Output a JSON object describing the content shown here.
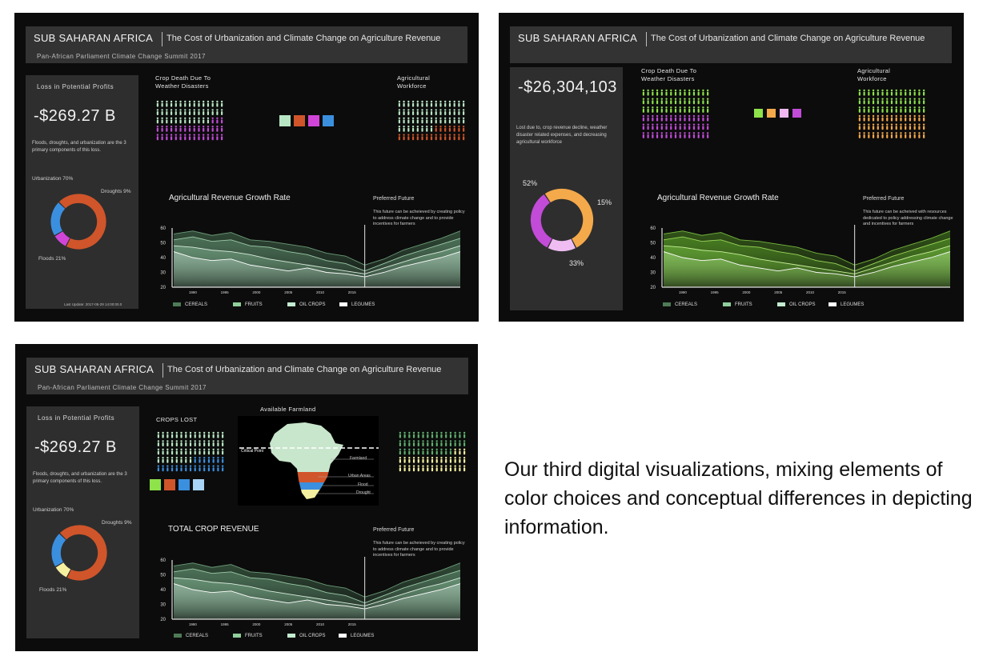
{
  "header": {
    "region": "SUB SAHARAN AFRICA",
    "title": "The Cost of Urbanization and Climate Change on Agriculture Revenue",
    "subtitle": "Pan-African Parliament Climate Change Summit 2017"
  },
  "caption": "Our third digital visualizations, mixing elements of color choices and conceptual differences in depicting information.",
  "colors": {
    "cereals": "#4e7a56",
    "fruits": "#8fcf9c",
    "oil_crops": "#c3ecd0",
    "legumes": "#ffffff",
    "orange": "#d0552a",
    "blue": "#3b8fdf",
    "magenta": "#d045d8"
  },
  "panel1": {
    "side_title": "Loss in Potential Profits",
    "big_value": "-$269.27 B",
    "description": "Floods, droughts, and urbanization are the 3 primary components of this loss.",
    "label_urbanization": "Urbanization 70%",
    "label_droughts": "Droughts 9%",
    "label_floods": "Floods 21%",
    "last_update": "Last Update: 2017-05-29 14:00:00.0",
    "crop_death_title": [
      "Crop Death Due To",
      "Weather Disasters"
    ],
    "workforce_title": [
      "Agricultural",
      "Workforce"
    ],
    "chart_title": "Agricultural Revenue Growth Rate",
    "preferred_title": "Preferred Future",
    "preferred_text": "This future can be acheieved by creating policy to address climate change and to provide incentives for farmers",
    "swatch_colors": [
      "#b8e6c4",
      "#d0552a",
      "#d045d8",
      "#3b8fdf"
    ],
    "donut": {
      "segments": [
        {
          "color": "#d0552a",
          "value": 70
        },
        {
          "color": "#d045d8",
          "value": 9
        },
        {
          "color": "#3b8fdf",
          "value": 21
        }
      ]
    }
  },
  "panel2": {
    "big_value": "-$26,304,103",
    "description": "Lost due to, crop revenue decline, weather disaster related expenses, and decreasing agricultural workforce",
    "pct_52": "52%",
    "pct_15": "15%",
    "pct_33": "33%",
    "crop_death_title": [
      "Crop Death Due To",
      "Weather Disasters"
    ],
    "workforce_title": [
      "Agricultural",
      "Workforce"
    ],
    "chart_title": "Agricultural Revenue Growth Rate",
    "preferred_title": "Preferred Future",
    "preferred_text": "This future can be acheived with resources dedicated to policy addressing climate change and incentives for farmers",
    "swatch_colors": [
      "#8ee24a",
      "#f4a94a",
      "#f0b8f0",
      "#c24bd8"
    ],
    "donut": {
      "segments": [
        {
          "color": "#f4a94a",
          "value": 52
        },
        {
          "color": "#efbdf2",
          "value": 15
        },
        {
          "color": "#c24bd8",
          "value": 33
        }
      ]
    }
  },
  "panel3": {
    "side_title": "Loss in Potential Profits",
    "big_value": "-$269.27 B",
    "description": "Floods, droughts, and urbanization are the 3 primary components of this loss.",
    "label_urbanization": "Urbanization 70%",
    "label_droughts": "Droughts 9%",
    "label_floods": "Floods 21%",
    "crops_lost_title": "CROPS LOST",
    "farmland_title": "Available Farmland",
    "critical_point": "Critical Point",
    "map_labels": [
      "Farmland",
      "Urban Areas",
      "Flood",
      "Drought"
    ],
    "chart_title": "TOTAL CROP REVENUE",
    "preferred_title": "Preferred Future",
    "preferred_text": "This future can be acheieved by creating policy to address climate change and to provide incentives for farmers",
    "swatch_colors": [
      "#8ee24a",
      "#d0552a",
      "#3b8fdf",
      "#a8d4f5"
    ],
    "donut": {
      "segments": [
        {
          "color": "#d0552a",
          "value": 70
        },
        {
          "color": "#f5f0a0",
          "value": 9
        },
        {
          "color": "#3b8fdf",
          "value": 21
        }
      ]
    }
  },
  "legend": [
    "CEREALS",
    "FRUITS",
    "OIL CROPS",
    "LEGUMES"
  ],
  "chart_data": {
    "type": "area",
    "x_ticks": [
      "1990",
      "1995",
      "2000",
      "2005",
      "2010",
      "2015"
    ],
    "y_ticks": [
      "20",
      "30",
      "40",
      "50",
      "60"
    ],
    "ylim": [
      20,
      60
    ],
    "x": [
      1987,
      1990,
      1993,
      1996,
      1999,
      2002,
      2005,
      2008,
      2011,
      2014,
      2017,
      2020,
      2023,
      2026,
      2029,
      2032
    ],
    "split_x": 2017,
    "series": [
      {
        "name": "CEREALS",
        "values": [
          56,
          58,
          55,
          57,
          52,
          51,
          49,
          47,
          43,
          41,
          35,
          39,
          45,
          49,
          53,
          58
        ]
      },
      {
        "name": "FRUITS",
        "values": [
          52,
          54,
          51,
          52,
          48,
          47,
          44,
          42,
          38,
          36,
          31,
          36,
          41,
          45,
          49,
          53
        ]
      },
      {
        "name": "OIL CROPS",
        "values": [
          48,
          47,
          45,
          44,
          42,
          39,
          37,
          35,
          33,
          31,
          29,
          33,
          37,
          41,
          44,
          48
        ]
      },
      {
        "name": "LEGUMES",
        "values": [
          44,
          40,
          38,
          39,
          35,
          33,
          31,
          33,
          30,
          29,
          27,
          30,
          34,
          37,
          40,
          44
        ]
      }
    ]
  }
}
